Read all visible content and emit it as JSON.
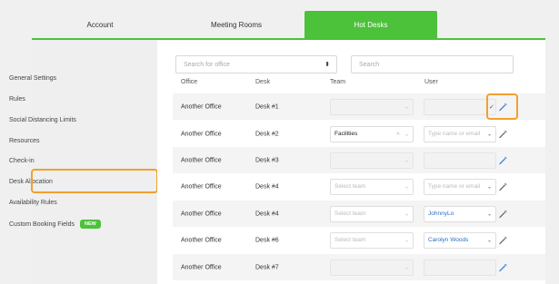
{
  "tabs": [
    {
      "label": "Account"
    },
    {
      "label": "Meeting Rooms"
    },
    {
      "label": "Hot Desks",
      "active": true
    }
  ],
  "accent_color": "#4cc13a",
  "highlight_color": "#f0a030",
  "sidebar": {
    "items": [
      {
        "label": "General Settings"
      },
      {
        "label": "Rules"
      },
      {
        "label": "Social Distancing Limits"
      },
      {
        "label": "Resources"
      },
      {
        "label": "Check-in"
      },
      {
        "label": "Desk Allocation",
        "highlighted": true
      },
      {
        "label": "Availability Rules"
      },
      {
        "label": "Custom Booking Fields",
        "badge": "NEW"
      }
    ]
  },
  "filters": {
    "office_placeholder": "Search for office",
    "search_placeholder": "Search"
  },
  "table": {
    "headers": [
      "Office",
      "Desk",
      "Team",
      "User"
    ],
    "rows": [
      {
        "office": "Another Office",
        "desk": "Desk #1",
        "team": "",
        "team_state": "disabled",
        "user": "",
        "user_state": "disabled",
        "checked": true,
        "wand_icon": "magic-wand-icon",
        "highlight_action": true
      },
      {
        "office": "Another Office",
        "desk": "Desk #2",
        "team": "Facilities",
        "team_state": "value",
        "user": "Type name or email",
        "user_state": "placeholder",
        "checked": false,
        "wand_icon": "magic-wand-icon"
      },
      {
        "office": "Another Office",
        "desk": "Desk #3",
        "team": "",
        "team_state": "disabled",
        "user": "",
        "user_state": "disabled",
        "checked": false,
        "wand_icon": "magic-wand-icon"
      },
      {
        "office": "Another Office",
        "desk": "Desk #4",
        "team": "Select team",
        "team_state": "placeholder",
        "user": "Type name or email",
        "user_state": "placeholder",
        "checked": false,
        "wand_icon": "magic-wand-icon"
      },
      {
        "office": "Another Office",
        "desk": "Desk #4",
        "team": "Select team",
        "team_state": "placeholder",
        "user": "JohnnyLo",
        "user_state": "value",
        "checked": false,
        "wand_icon": "magic-wand-icon"
      },
      {
        "office": "Another Office",
        "desk": "Desk #6",
        "team": "Select team",
        "team_state": "placeholder",
        "user": "Carolyn Woods",
        "user_state": "value",
        "checked": false,
        "wand_icon": "magic-wand-icon"
      },
      {
        "office": "Another Office",
        "desk": "Desk #7",
        "team": "",
        "team_state": "disabled",
        "user": "",
        "user_state": "disabled",
        "checked": false,
        "wand_icon": "magic-wand-icon"
      }
    ]
  }
}
